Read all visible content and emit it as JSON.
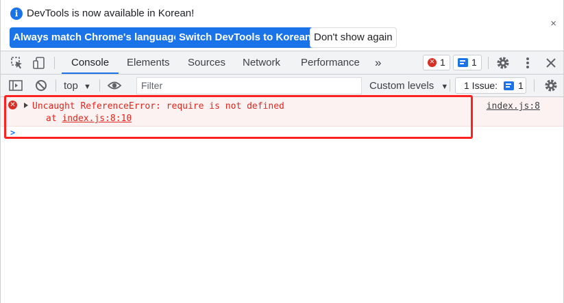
{
  "infobar": {
    "message": "DevTools is now available in Korean!",
    "btn_match": "Always match Chrome's language",
    "btn_switch": "Switch DevTools to Korean",
    "btn_dont_show": "Don't show again",
    "close": "×"
  },
  "tabs": {
    "items": [
      "Console",
      "Elements",
      "Sources",
      "Network",
      "Performance"
    ],
    "more": "»",
    "error_count": "1",
    "message_count": "1"
  },
  "console_toolbar": {
    "context": "top",
    "filter_placeholder": "Filter",
    "levels": "Custom levels",
    "issues_label": "1 Issue:",
    "issues_count": "1"
  },
  "messages": {
    "error_text": "Uncaught ReferenceError: require is not defined",
    "stack_prefix": "at ",
    "stack_link": "index.js:8:10",
    "source_link": "index.js:8"
  },
  "prompt": ">",
  "colors": {
    "accent": "#1a73e8",
    "error": "#e1251b",
    "highlight": "#ff2020"
  }
}
